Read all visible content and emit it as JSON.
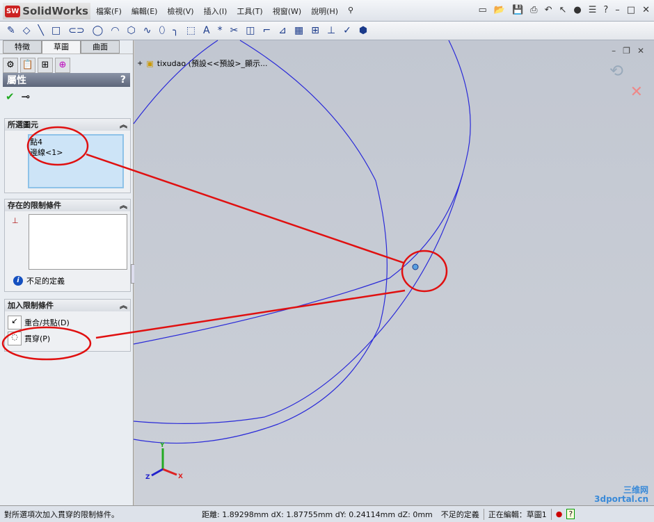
{
  "app": {
    "title": "SolidWorks",
    "badge": "SW"
  },
  "menu": [
    "檔案(F)",
    "編輯(E)",
    "檢視(V)",
    "插入(I)",
    "工具(T)",
    "視窗(W)",
    "說明(H)"
  ],
  "panel": {
    "tabs": [
      "特徵",
      "草圖",
      "曲面"
    ],
    "active_tab": "草圖",
    "title": "屬性",
    "help": "?",
    "selected": {
      "header": "所選圖元",
      "items": [
        "點4",
        "邊線<1>"
      ]
    },
    "existing": {
      "header": "存在的限制條件",
      "status": "不足的定義"
    },
    "add": {
      "header": "加入限制條件",
      "items": [
        "重合/共點(D)",
        "貫穿(P)"
      ]
    }
  },
  "tree": {
    "label": "tixudao (預設<<預設>_顯示..."
  },
  "statusbar": {
    "message": "對所選項次加入貫穿的限制條件。",
    "measure": "距離: 1.89298mm dX: 1.87755mm dY: 0.24114mm dZ: 0mm",
    "definition": "不足的定義",
    "editing": "正在編輯：草圖1",
    "help": "?"
  },
  "watermark": "三维网 3dportal.cn",
  "triad": {
    "x": "X",
    "y": "Y",
    "z": "Z"
  },
  "colors": {
    "sketch": "#2a2ad8",
    "annotation": "#e01010",
    "point": "#5aa0e0"
  }
}
